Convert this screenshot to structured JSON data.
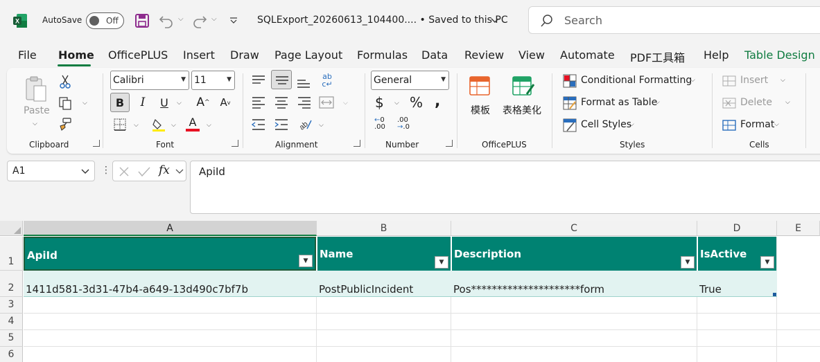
{
  "titlebar": {
    "autosave_label": "AutoSave",
    "toggle_state": "Off",
    "doc_title": "SQLExport_20260613_104400.... • Saved to this PC",
    "search_placeholder": "Search"
  },
  "menu": {
    "tabs": [
      "File",
      "Home",
      "OfficePLUS",
      "Insert",
      "Draw",
      "Page Layout",
      "Formulas",
      "Data",
      "Review",
      "View",
      "Automate",
      "PDF工具箱",
      "Help",
      "Table Design"
    ],
    "active": "Home"
  },
  "ribbon": {
    "clipboard": {
      "label": "Clipboard",
      "paste": "Paste"
    },
    "font": {
      "label": "Font",
      "family": "Calibri",
      "size": "11"
    },
    "alignment": {
      "label": "Alignment"
    },
    "number": {
      "label": "Number",
      "format": "General",
      "currency": "$",
      "percent": "%"
    },
    "officeplus": {
      "label": "OfficePLUS",
      "template": "模板",
      "beautify": "表格美化"
    },
    "styles": {
      "label": "Styles",
      "conditional": "Conditional Formatting",
      "format_table": "Format as Table",
      "cell_styles": "Cell Styles"
    },
    "cells": {
      "label": "Cells",
      "insert": "Insert",
      "delete": "Delete",
      "format": "Format"
    }
  },
  "formula_bar": {
    "name_box": "A1",
    "fx": "fx",
    "content": "ApiId"
  },
  "grid": {
    "columns": [
      "A",
      "B",
      "C",
      "D",
      "E"
    ],
    "rows": [
      "1",
      "2",
      "3",
      "4",
      "5",
      "6"
    ],
    "headers": [
      "ApiId",
      "Name",
      "Description",
      "IsActive"
    ],
    "data": [
      [
        "1411d581-3d31-47b4-a649-13d490c7bf7b",
        "PostPublicIncident",
        "Pos*********************form",
        "True"
      ]
    ]
  },
  "colors": {
    "accent": "#107c41",
    "table_header": "#008272",
    "table_row": "#e2f3f1"
  }
}
